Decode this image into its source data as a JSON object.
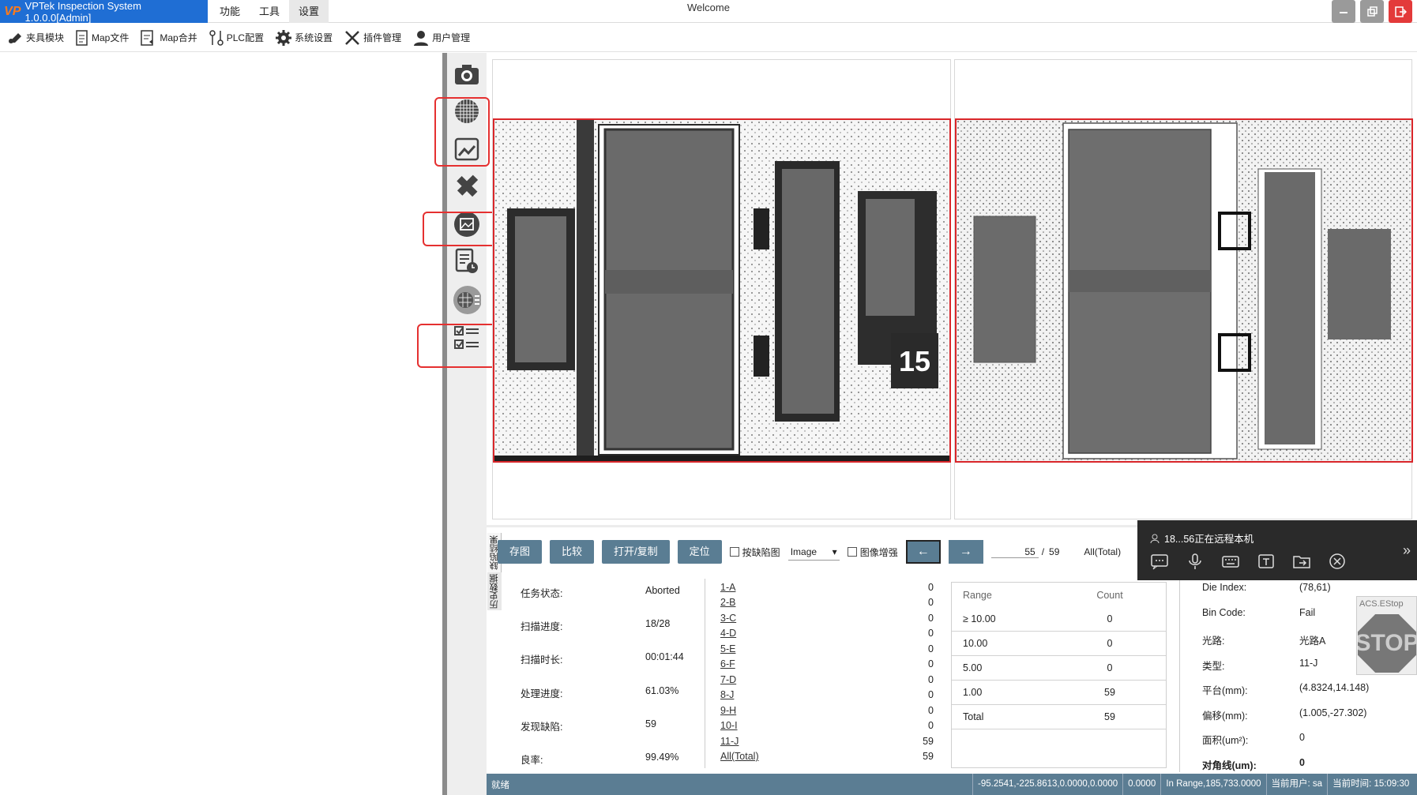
{
  "app": {
    "logo": "VP",
    "title": "VPTek Inspection System 1.0.0.0[Admin]",
    "window_title": "Welcome"
  },
  "menu": [
    "功能",
    "工具",
    "设置"
  ],
  "toolbar": {
    "fixture": "夹具模块",
    "map_file": "Map文件",
    "map_merge": "Map合并",
    "plc": "PLC配置",
    "sys": "系统设置",
    "plugin": "插件管理",
    "user": "用户管理"
  },
  "buttons": {
    "save_img": "存图",
    "compare": "比较",
    "open_copy": "打开/复制",
    "locate": "定位",
    "prev": "←",
    "next": "→"
  },
  "checks": {
    "defect_graph": "按缺陷图",
    "enhance": "图像增强"
  },
  "view_select": "Image",
  "pager": {
    "current": "55",
    "sep": "/",
    "total": "59"
  },
  "filter_select": "All(Total)",
  "tabs": {
    "defect_result": "缺陷结果",
    "history": "历史数据"
  },
  "status": [
    {
      "k": "任务状态:",
      "v": "Aborted"
    },
    {
      "k": "扫描进度:",
      "v": "18/28"
    },
    {
      "k": "扫描时长:",
      "v": "00:01:44"
    },
    {
      "k": "处理进度:",
      "v": "61.03%"
    },
    {
      "k": "发现缺陷:",
      "v": "59"
    },
    {
      "k": "良率:",
      "v": "99.49%"
    }
  ],
  "defects": [
    {
      "n": "1-A",
      "c": "0"
    },
    {
      "n": "2-B",
      "c": "0"
    },
    {
      "n": "3-C",
      "c": "0"
    },
    {
      "n": "4-D",
      "c": "0"
    },
    {
      "n": "5-E",
      "c": "0"
    },
    {
      "n": "6-F",
      "c": "0"
    },
    {
      "n": "7-D",
      "c": "0"
    },
    {
      "n": "8-J",
      "c": "0"
    },
    {
      "n": "9-H",
      "c": "0"
    },
    {
      "n": "10-I",
      "c": "0"
    },
    {
      "n": "11-J",
      "c": "59"
    },
    {
      "n": "All(Total)",
      "c": "59"
    }
  ],
  "range_table": {
    "headers": [
      "Range",
      "Count"
    ],
    "rows": [
      {
        "r": "≥ 10.00",
        "c": "0"
      },
      {
        "r": "10.00",
        "c": "0"
      },
      {
        "r": "5.00",
        "c": "0"
      },
      {
        "r": "1.00",
        "c": "59"
      },
      {
        "r": "Total",
        "c": "59"
      }
    ]
  },
  "info": [
    {
      "k": "Die Index:",
      "v": "(78,61)"
    },
    {
      "k": "Bin Code:",
      "v": "Fail"
    },
    {
      "k": "光路:",
      "v": "光路A"
    },
    {
      "k": "类型:",
      "v": "11-J"
    },
    {
      "k": "平台(mm):",
      "v": "(4.8324,14.148)"
    },
    {
      "k": "偏移(mm):",
      "v": "(1.005,-27.302)"
    },
    {
      "k": "面积(um²):",
      "v": "0"
    },
    {
      "k": "对角线(um):",
      "v": "0"
    }
  ],
  "remote": {
    "text": "18...56正在远程本机"
  },
  "estop": {
    "label": "ACS.EStop",
    "sign": "STOP"
  },
  "statusbar": {
    "ready": "就绪",
    "coords": "-95.2541,-225.8613,0.0000,0.0000",
    "val": "0.0000",
    "range": "In Range,185,733.0000",
    "user": "当前用户: sa",
    "time": "当前时间: 15:09:30"
  },
  "colors": {
    "accent": "#1f6ed4",
    "button": "#5a7d93",
    "highlight": "#e53030"
  }
}
